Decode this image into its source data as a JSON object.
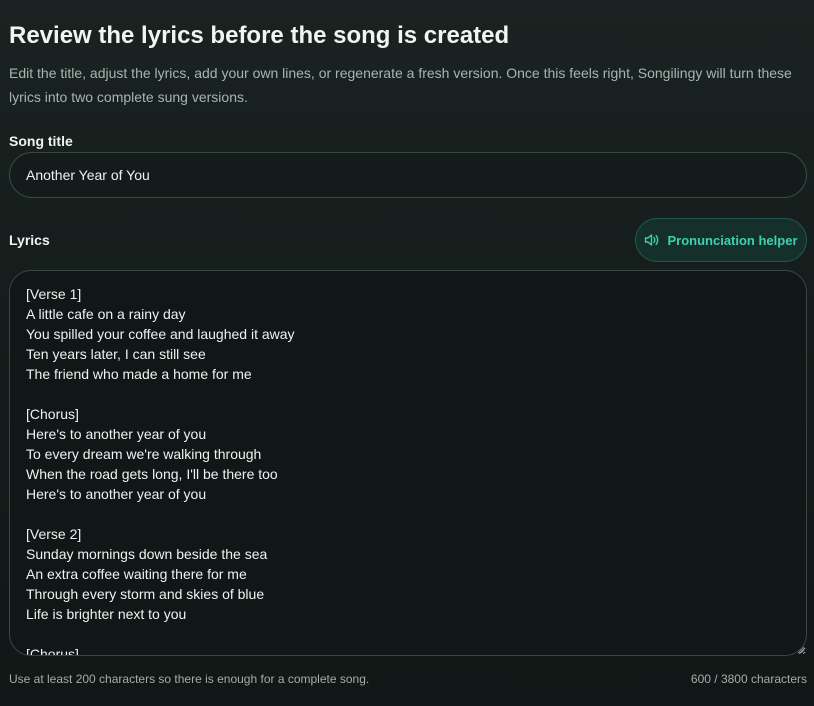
{
  "page": {
    "title": "Review the lyrics before the song is created",
    "description": "Edit the title, adjust the lyrics, add your own lines, or regenerate a fresh version. Once this feels right, Songilingy will turn these lyrics into two complete sung versions."
  },
  "song_title": {
    "label": "Song title",
    "value": "Another Year of You"
  },
  "lyrics": {
    "label": "Lyrics",
    "helper_button": {
      "label": "Pronunciation helper",
      "icon": "speaker-icon"
    },
    "value": "[Verse 1]\nA little cafe on a rainy day\nYou spilled your coffee and laughed it away\nTen years later, I can still see\nThe friend who made a home for me\n\n[Chorus]\nHere's to another year of you\nTo every dream we're walking through\nWhen the road gets long, I'll be there too\nHere's to another year of you\n\n[Verse 2]\nSunday mornings down beside the sea\nAn extra coffee waiting there for me\nThrough every storm and skies of blue\nLife is brighter next to you\n\n[Chorus]",
    "hint": "Use at least 200 characters so there is enough for a complete song.",
    "counter": "600 / 3800 characters"
  },
  "colors": {
    "accent": "#3fd1ae",
    "background": "#161e1d",
    "border": "#3a4745"
  }
}
